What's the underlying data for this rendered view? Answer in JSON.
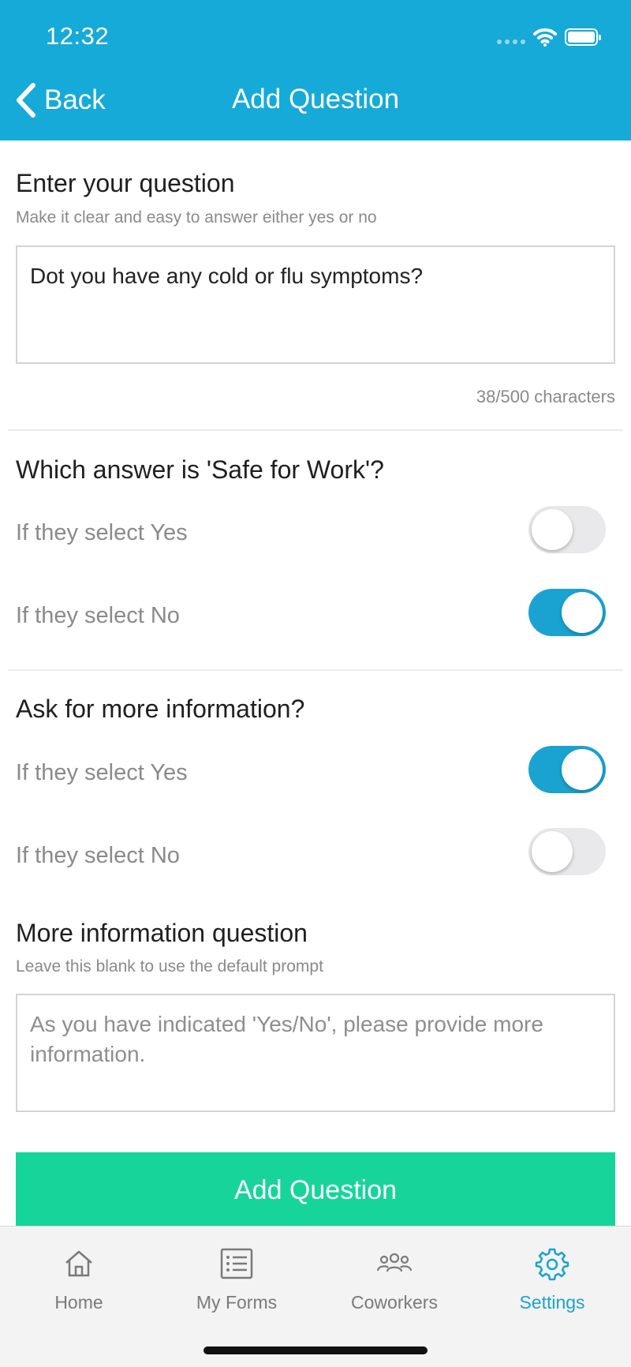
{
  "status_bar": {
    "time": "12:32"
  },
  "nav": {
    "back_label": "Back",
    "title": "Add Question"
  },
  "question": {
    "title": "Enter your question",
    "helper": "Make it clear and easy to answer either yes or no",
    "value": "Dot you have any cold or flu symptoms?",
    "counter": "38/500 characters"
  },
  "safe_for_work": {
    "title": "Which answer is 'Safe for Work'?",
    "rows": [
      {
        "label": "If they select Yes",
        "on": false
      },
      {
        "label": "If they select No",
        "on": true
      }
    ]
  },
  "more_info": {
    "title": "Ask for more information?",
    "rows": [
      {
        "label": "If they select Yes",
        "on": true
      },
      {
        "label": "If they select No",
        "on": false
      }
    ]
  },
  "more_info_question": {
    "title": "More information question",
    "helper": "Leave this blank to use the default prompt",
    "placeholder": " As you have indicated 'Yes/No', please provide more information."
  },
  "add_button": {
    "label": "Add Question"
  },
  "tabs": [
    {
      "label": "Home",
      "icon": "home-icon",
      "active": false
    },
    {
      "label": "My Forms",
      "icon": "list-icon",
      "active": false
    },
    {
      "label": "Coworkers",
      "icon": "people-icon",
      "active": false
    },
    {
      "label": "Settings",
      "icon": "gear-icon",
      "active": true
    }
  ],
  "colors": {
    "header": "#16aad8",
    "accent": "#1aa3d1",
    "button": "#17d59a"
  }
}
